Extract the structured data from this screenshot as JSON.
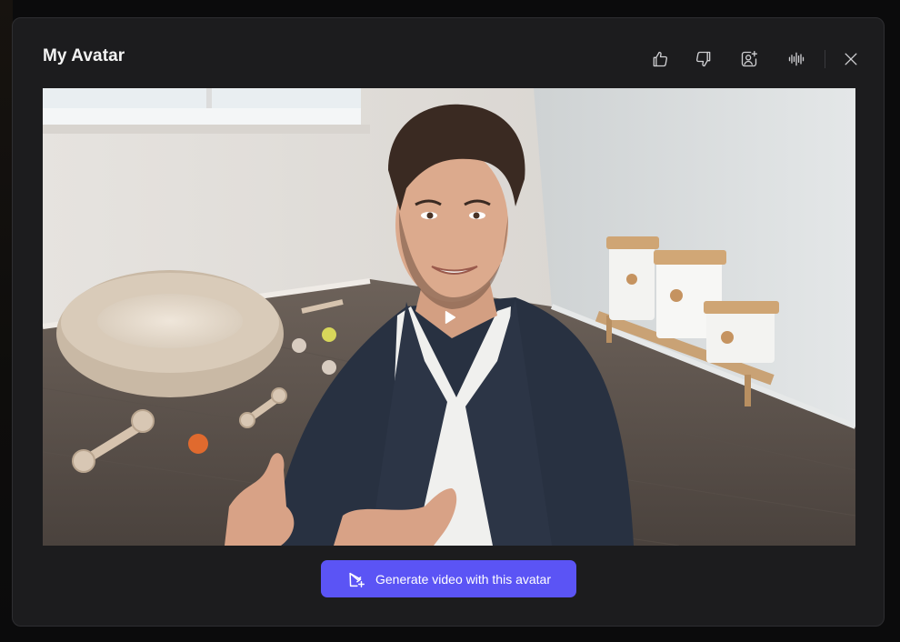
{
  "modal": {
    "title": "My Avatar"
  },
  "toolbar": {
    "icons": [
      "thumbs-up-icon",
      "thumbs-down-icon",
      "avatar-add-icon",
      "voice-waveform-icon",
      "close-icon"
    ]
  },
  "video": {
    "play_icon": "play-icon"
  },
  "actions": {
    "generate_label": "Generate video with this avatar",
    "generate_icon": "video-add-icon"
  },
  "colors": {
    "accent": "#5b54f5",
    "modal_bg": "#1c1c1e",
    "page_bg": "#0b0b0c"
  }
}
